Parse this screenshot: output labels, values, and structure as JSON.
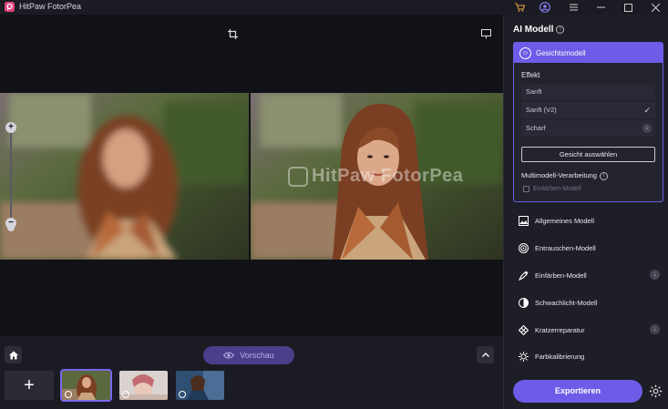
{
  "app": {
    "title": "HitPaw FotorPea"
  },
  "colors": {
    "accent": "#6c5ce7",
    "background": "#1b1b23",
    "panel": "#1e1e27"
  },
  "canvas": {
    "watermark": "HitPaw FotorPea"
  },
  "bottom": {
    "preview_label": "Vorschau"
  },
  "panel": {
    "title": "AI Modell",
    "face_model": {
      "label": "Gesichtsmodell",
      "effect_label": "Effekt",
      "options": [
        {
          "label": "Sanft",
          "state": "none"
        },
        {
          "label": "Sanft (V2)",
          "state": "selected"
        },
        {
          "label": "Scharf",
          "state": "download"
        }
      ],
      "select_face_label": "Gesicht auswählen",
      "multi_model_label": "Multimodell-Verarbeitung",
      "colorize_checkbox_label": "Einfärben-Modell"
    },
    "models": [
      {
        "label": "Allgemeines Modell",
        "icon": "image-icon",
        "download": false
      },
      {
        "label": "Entrauschen-Modell",
        "icon": "denoise-icon",
        "download": false
      },
      {
        "label": "Einfärben-Modell",
        "icon": "colorize-icon",
        "download": true
      },
      {
        "label": "Schwachlicht-Modell",
        "icon": "lowlight-icon",
        "download": false
      },
      {
        "label": "Kratzerreparatur",
        "icon": "scratch-repair-icon",
        "download": true
      },
      {
        "label": "Farbkalibrierung",
        "icon": "color-calibration-icon",
        "download": false
      }
    ],
    "export_label": "Exportieren"
  }
}
